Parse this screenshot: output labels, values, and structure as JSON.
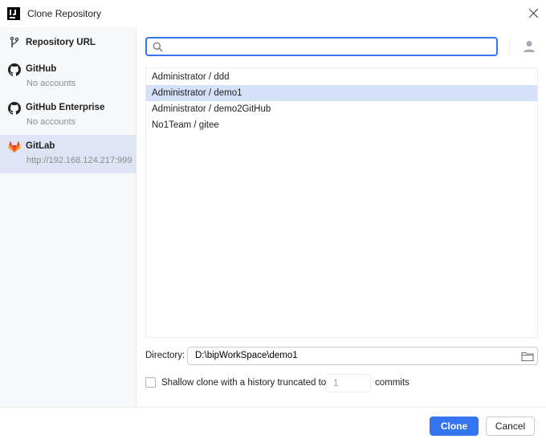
{
  "window": {
    "title": "Clone Repository"
  },
  "sidebar": {
    "items": [
      {
        "title": "Repository URL",
        "subtitle": "",
        "icon": "vcs-branch-icon"
      },
      {
        "title": "GitHub",
        "subtitle": "No accounts",
        "icon": "github-icon"
      },
      {
        "title": "GitHub Enterprise",
        "subtitle": "No accounts",
        "icon": "github-icon"
      },
      {
        "title": "GitLab",
        "subtitle": "http://192.168.124.217:999",
        "icon": "gitlab-icon"
      }
    ],
    "selected": "GitLab"
  },
  "search": {
    "value": "",
    "placeholder": ""
  },
  "repositories": [
    "Administrator / ddd",
    "Administrator / demo1",
    "Administrator / demo2GitHub",
    "No1Team / gitee"
  ],
  "selected_repository": "Administrator / demo1",
  "directory": {
    "label": "Directory:",
    "value": "D:\\bipWorkSpace\\demo1"
  },
  "shallow": {
    "label": "Shallow clone with a history truncated to",
    "depth": "1",
    "suffix": "commits",
    "checked": false
  },
  "buttons": {
    "clone": "Clone",
    "cancel": "Cancel"
  },
  "colors": {
    "accent": "#3574f0",
    "selection": "#d5e1f8",
    "sidebar_selection": "#dfe4f4",
    "gitlab": "#e24329"
  }
}
